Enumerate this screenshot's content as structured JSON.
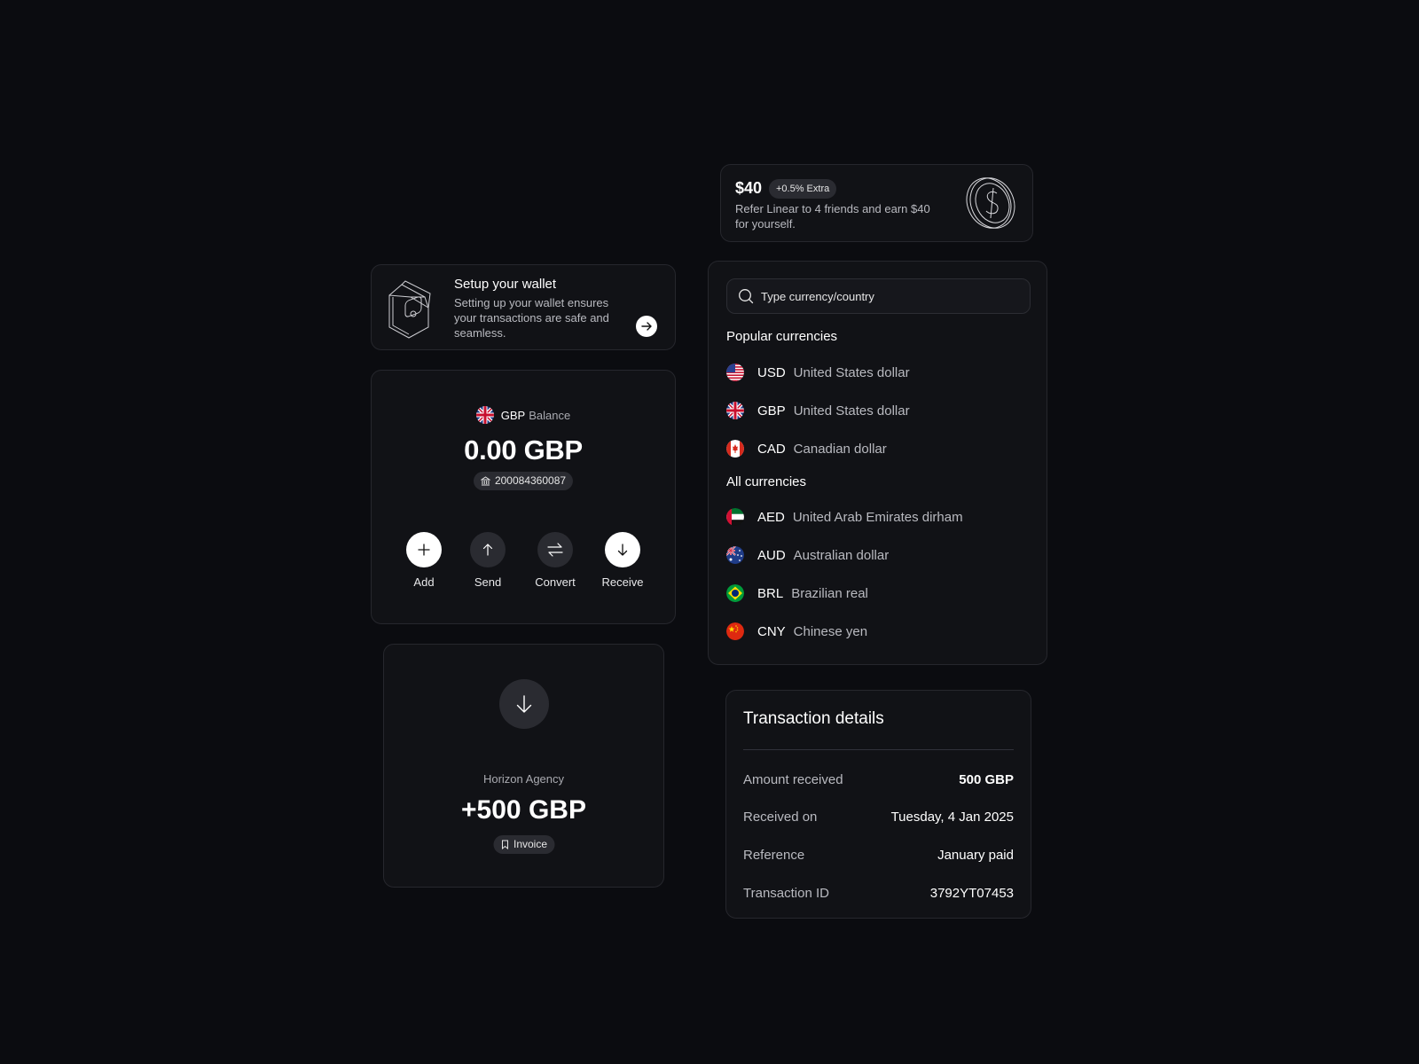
{
  "referral": {
    "amount": "$40",
    "badge": "+0.5% Extra",
    "description": "Refer Linear to 4 friends and earn $40 for yourself.",
    "icon": "dollar-coin-icon"
  },
  "wallet_setup": {
    "title": "Setup your wallet",
    "description": "Setting up your wallet ensures your transactions are safe and seamless.",
    "icon": "wallet-icon"
  },
  "balance": {
    "currency": "GBP",
    "label": "Balance",
    "amount": "0.00 GBP",
    "account_number": "200084360087",
    "actions": [
      {
        "label": "Add",
        "icon": "plus-icon"
      },
      {
        "label": "Send",
        "icon": "arrow-up-icon"
      },
      {
        "label": "Convert",
        "icon": "swap-icon"
      },
      {
        "label": "Receive",
        "icon": "arrow-down-icon"
      }
    ]
  },
  "received": {
    "from": "Horizon Agency",
    "amount": "+500 GBP",
    "badge": "Invoice"
  },
  "currency_picker": {
    "search_placeholder": "Type currency/country",
    "popular_title": "Popular currencies",
    "popular": [
      {
        "code": "USD",
        "name": "United States dollar"
      },
      {
        "code": "GBP",
        "name": "United States dollar"
      },
      {
        "code": "CAD",
        "name": "Canadian dollar"
      }
    ],
    "all_title": "All currencies",
    "all": [
      {
        "code": "AED",
        "name": "United Arab Emirates dirham"
      },
      {
        "code": "AUD",
        "name": "Australian dollar"
      },
      {
        "code": "BRL",
        "name": "Brazilian real"
      },
      {
        "code": "CNY",
        "name": "Chinese yen"
      }
    ]
  },
  "transaction": {
    "title": "Transaction details",
    "rows": [
      {
        "label": "Amount received",
        "value": "500 GBP"
      },
      {
        "label": "Received on",
        "value": "Tuesday, 4 Jan 2025"
      },
      {
        "label": "Reference",
        "value": "January paid"
      },
      {
        "label": "Transaction ID",
        "value": "3792YT07453"
      }
    ]
  }
}
